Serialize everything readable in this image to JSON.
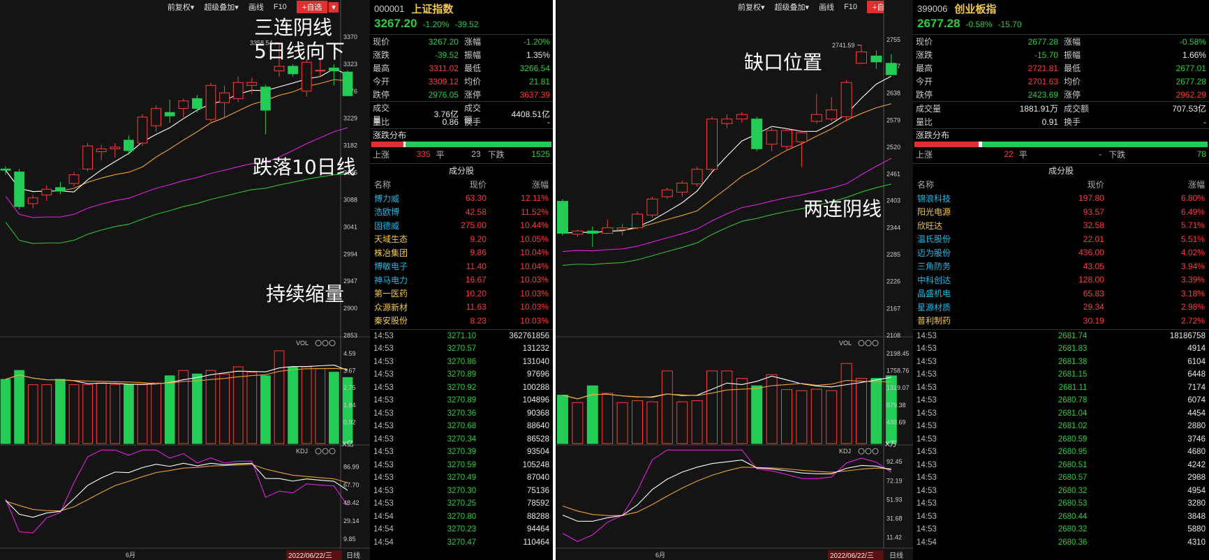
{
  "toolbar": {
    "restore": "前复权▾",
    "overlay": "超级叠加▾",
    "draw": "画线",
    "f10": "F10",
    "favorite": "+自选",
    "favorite_arrow": "▾",
    "close": "✕"
  },
  "colors": {
    "up": "#ff3b3b",
    "down": "#22cc55",
    "ma5": "#ffffff",
    "ma10": "#f0a030",
    "ma20": "#e020e0",
    "ma60": "#30c030"
  },
  "left_chart": {
    "price_axis": [
      "3370",
      "3323",
      "3276",
      "3229",
      "3182",
      "3135",
      "3088",
      "3041",
      "2994",
      "2947",
      "2900",
      "2853"
    ],
    "peak_label": "3358.54",
    "vol_label": "VOL",
    "vol_axis": [
      "4.59",
      "3.67",
      "2.75",
      "1.84",
      "0.92"
    ],
    "vol_unit": "X亿",
    "kdj_label": "KDJ",
    "kdj_axis": [
      "86.99",
      "67.70",
      "48.42",
      "29.14",
      "9.85"
    ],
    "month_label": "6月",
    "date_label": "2022/06/22/三",
    "period_label": "日线",
    "annotations": [
      "三连阴线",
      "5日线向下",
      "跌落10日线",
      "持续缩量"
    ],
    "candles": [
      {
        "o": 3140,
        "c": 3138,
        "h": 3145,
        "l": 3130
      },
      {
        "o": 3135,
        "c": 3075,
        "h": 3140,
        "l": 3070
      },
      {
        "o": 3080,
        "c": 3090,
        "h": 3095,
        "l": 3072
      },
      {
        "o": 3095,
        "c": 3105,
        "h": 3112,
        "l": 3085
      },
      {
        "o": 3108,
        "c": 3102,
        "h": 3118,
        "l": 3096
      },
      {
        "o": 3115,
        "c": 3130,
        "h": 3135,
        "l": 3110
      },
      {
        "o": 3140,
        "c": 3180,
        "h": 3185,
        "l": 3136
      },
      {
        "o": 3170,
        "c": 3175,
        "h": 3182,
        "l": 3155
      },
      {
        "o": 3175,
        "c": 3178,
        "h": 3185,
        "l": 3160
      },
      {
        "o": 3190,
        "c": 3172,
        "h": 3198,
        "l": 3165
      },
      {
        "o": 3185,
        "c": 3230,
        "h": 3235,
        "l": 3180
      },
      {
        "o": 3215,
        "c": 3245,
        "h": 3250,
        "l": 3205
      },
      {
        "o": 3238,
        "c": 3232,
        "h": 3260,
        "l": 3220
      },
      {
        "o": 3245,
        "c": 3258,
        "h": 3262,
        "l": 3230
      },
      {
        "o": 3262,
        "c": 3245,
        "h": 3268,
        "l": 3238
      },
      {
        "o": 3226,
        "c": 3285,
        "h": 3290,
        "l": 3222
      },
      {
        "o": 3255,
        "c": 3272,
        "h": 3285,
        "l": 3228
      },
      {
        "o": 3262,
        "c": 3290,
        "h": 3300,
        "l": 3256
      },
      {
        "o": 3285,
        "c": 3290,
        "h": 3298,
        "l": 3270
      },
      {
        "o": 3282,
        "c": 3242,
        "h": 3286,
        "l": 3200
      },
      {
        "o": 3310,
        "c": 3318,
        "h": 3358.54,
        "l": 3300
      },
      {
        "o": 3318,
        "c": 3305,
        "h": 3322,
        "l": 3300
      },
      {
        "o": 3275,
        "c": 3325,
        "h": 3330,
        "l": 3265
      },
      {
        "o": 3310,
        "c": 3311,
        "h": 3330,
        "l": 3300
      },
      {
        "o": 3315,
        "c": 3310,
        "h": 3322,
        "l": 3285
      },
      {
        "o": 3308,
        "c": 3267,
        "h": 3311,
        "l": 3266
      }
    ],
    "vol": [
      3.6,
      4.1,
      3.3,
      3.3,
      3.6,
      3.3,
      3.3,
      3.4,
      3.3,
      3.3,
      3.3,
      3.4,
      3.8,
      4.1,
      3.9,
      4.1,
      3.9,
      4.3,
      4.0,
      3.8,
      5.2,
      4.3,
      4.3,
      4.2,
      4.0,
      3.7
    ]
  },
  "left_quote": {
    "code": "000001",
    "name": "上证指数",
    "price": "3267.20",
    "pct": "-1.20%",
    "chg": "-39.52",
    "stats": [
      [
        "现价",
        "3267.20",
        "涨幅",
        "-1.20%"
      ],
      [
        "涨跌",
        "-39.52",
        "振幅",
        "1.35%"
      ],
      [
        "最高",
        "3311.02",
        "最低",
        "3266.54"
      ],
      [
        "今开",
        "3309.12",
        "均价",
        "21.81"
      ],
      [
        "跌停",
        "2976.05",
        "涨停",
        "3637.39"
      ],
      [
        "成交量",
        "3.76亿",
        "成交额",
        "4408.51亿"
      ],
      [
        "量比",
        "0.86",
        "换手",
        "-"
      ]
    ],
    "dist_title": "涨跌分布",
    "dist": {
      "up_label": "上涨",
      "up": "335",
      "flat_label": "平",
      "flat": "23",
      "down_label": "下跌",
      "down": "1525"
    },
    "comp_title": "成分股",
    "comp_head": [
      "名称",
      "现价",
      "涨幅"
    ],
    "components": [
      [
        "博力威",
        "63.30",
        "12.11%"
      ],
      [
        "浩欧博",
        "42.58",
        "11.52%"
      ],
      [
        "固德威",
        "275.00",
        "10.44%"
      ],
      [
        "天域生态",
        "9.20",
        "10.05%"
      ],
      [
        "株冶集团",
        "9.86",
        "10.04%"
      ],
      [
        "博敏电子",
        "11.40",
        "10.04%"
      ],
      [
        "神马电力",
        "16.67",
        "10.03%"
      ],
      [
        "第一医药",
        "10.20",
        "10.03%"
      ],
      [
        "众源新材",
        "11.63",
        "10.03%"
      ],
      [
        "秦安股份",
        "8.23",
        "10.03%"
      ]
    ],
    "trades": [
      [
        "14:53",
        "3271.10",
        "362761856"
      ],
      [
        "14:53",
        "3270.57",
        "131232"
      ],
      [
        "14:53",
        "3270.86",
        "131040"
      ],
      [
        "14:53",
        "3270.89",
        "97696"
      ],
      [
        "14:53",
        "3270.92",
        "100288"
      ],
      [
        "14:53",
        "3270.89",
        "104896"
      ],
      [
        "14:53",
        "3270.36",
        "90368"
      ],
      [
        "14:53",
        "3270.68",
        "88640"
      ],
      [
        "14:53",
        "3270.34",
        "86528"
      ],
      [
        "14:53",
        "3270.39",
        "93504"
      ],
      [
        "14:53",
        "3270.59",
        "105248"
      ],
      [
        "14:53",
        "3270.49",
        "87040"
      ],
      [
        "14:53",
        "3270.30",
        "75136"
      ],
      [
        "14:53",
        "3270.25",
        "78592"
      ],
      [
        "14:54",
        "3270.80",
        "88288"
      ],
      [
        "14:54",
        "3270.23",
        "94464"
      ],
      [
        "14:54",
        "3270.47",
        "110464"
      ]
    ]
  },
  "right_chart": {
    "price_axis": [
      "2755",
      "2697",
      "2638",
      "2579",
      "2520",
      "2461",
      "2403",
      "2344",
      "2285",
      "2226",
      "2167",
      "2108"
    ],
    "peak_label": "2741.59",
    "vol_label": "VOL",
    "vol_axis": [
      "2198.45",
      "1758.76",
      "1319.07",
      "879.38",
      "439.69"
    ],
    "vol_unit": "X万",
    "kdj_label": "KDJ",
    "kdj_axis": [
      "92.45",
      "72.19",
      "51.93",
      "31.68",
      "11.42"
    ],
    "month_label": "6月",
    "date_label": "2022/06/22/三",
    "period_label": "日线",
    "annotations": [
      "缺口位置",
      "两连阴线"
    ],
    "candles": [
      {
        "o": 2400,
        "c": 2330,
        "h": 2405,
        "l": 2325
      },
      {
        "o": 2328,
        "c": 2335,
        "h": 2338,
        "l": 2322
      },
      {
        "o": 2335,
        "c": 2330,
        "h": 2345,
        "l": 2300
      },
      {
        "o": 2330,
        "c": 2342,
        "h": 2360,
        "l": 2328
      },
      {
        "o": 2338,
        "c": 2342,
        "h": 2350,
        "l": 2325
      },
      {
        "o": 2342,
        "c": 2372,
        "h": 2378,
        "l": 2338
      },
      {
        "o": 2370,
        "c": 2405,
        "h": 2410,
        "l": 2365
      },
      {
        "o": 2410,
        "c": 2425,
        "h": 2430,
        "l": 2405
      },
      {
        "o": 2420,
        "c": 2440,
        "h": 2445,
        "l": 2410
      },
      {
        "o": 2438,
        "c": 2470,
        "h": 2475,
        "l": 2432
      },
      {
        "o": 2470,
        "c": 2580,
        "h": 2585,
        "l": 2465
      },
      {
        "o": 2570,
        "c": 2580,
        "h": 2590,
        "l": 2560
      },
      {
        "o": 2580,
        "c": 2590,
        "h": 2595,
        "l": 2572
      },
      {
        "o": 2580,
        "c": 2515,
        "h": 2585,
        "l": 2510
      },
      {
        "o": 2525,
        "c": 2555,
        "h": 2565,
        "l": 2510
      },
      {
        "o": 2520,
        "c": 2555,
        "h": 2560,
        "l": 2510
      },
      {
        "o": 2530,
        "c": 2550,
        "h": 2555,
        "l": 2475
      },
      {
        "o": 2575,
        "c": 2590,
        "h": 2635,
        "l": 2570
      },
      {
        "o": 2580,
        "c": 2600,
        "h": 2628,
        "l": 2575
      },
      {
        "o": 2585,
        "c": 2660,
        "h": 2665,
        "l": 2575
      },
      {
        "o": 2702,
        "c": 2727,
        "h": 2741.59,
        "l": 2700
      },
      {
        "o": 2718,
        "c": 2705,
        "h": 2730,
        "l": 2690
      },
      {
        "o": 2702,
        "c": 2677,
        "h": 2722,
        "l": 2677
      }
    ],
    "vol": [
      1300,
      1100,
      1550,
      1350,
      1100,
      1150,
      1120,
      1950,
      1120,
      1150,
      1950,
      1950,
      1750,
      1550,
      1850,
      1450,
      1420,
      1460,
      1420,
      2150,
      1750,
      1750,
      1820
    ]
  },
  "right_quote": {
    "code": "399006",
    "name": "创业板指",
    "price": "2677.28",
    "pct": "-0.58%",
    "chg": "-15.70",
    "stats": [
      [
        "现价",
        "2677.28",
        "涨幅",
        "-0.58%"
      ],
      [
        "涨跌",
        "-15.70",
        "振幅",
        "1.66%"
      ],
      [
        "最高",
        "2721.81",
        "最低",
        "2677.01"
      ],
      [
        "今开",
        "2701.63",
        "均价",
        "2677.28"
      ],
      [
        "跌停",
        "2423.69",
        "涨停",
        "2962.29"
      ],
      [
        "成交量",
        "1881.91万",
        "成交额",
        "707.53亿"
      ],
      [
        "量比",
        "0.91",
        "换手",
        "-"
      ]
    ],
    "dist_title": "涨跌分布",
    "dist": {
      "up_label": "上涨",
      "up": "22",
      "flat_label": "平",
      "flat": "-",
      "down_label": "下跌",
      "down": "78"
    },
    "comp_title": "成分股",
    "comp_head": [
      "名称",
      "现价",
      "涨幅"
    ],
    "components": [
      [
        "锦浪科技",
        "197.80",
        "6.80%"
      ],
      [
        "阳光电源",
        "93.57",
        "6.49%"
      ],
      [
        "欣旺达",
        "32.58",
        "5.71%"
      ],
      [
        "温氏股份",
        "22.01",
        "5.51%"
      ],
      [
        "迈为股份",
        "436.00",
        "4.02%"
      ],
      [
        "三角防务",
        "43.05",
        "3.94%"
      ],
      [
        "中科创达",
        "128.00",
        "3.39%"
      ],
      [
        "晶盛机电",
        "65.83",
        "3.18%"
      ],
      [
        "星源材质",
        "29.34",
        "2.98%"
      ],
      [
        "普利制药",
        "30.19",
        "2.72%"
      ]
    ],
    "trades": [
      [
        "14:53",
        "2681.74",
        "18186758"
      ],
      [
        "14:53",
        "2681.83",
        "4914"
      ],
      [
        "14:53",
        "2681.38",
        "6104"
      ],
      [
        "14:53",
        "2681.15",
        "6448"
      ],
      [
        "14:53",
        "2681.11",
        "7174"
      ],
      [
        "14:53",
        "2680.78",
        "6074"
      ],
      [
        "14:53",
        "2681.04",
        "4454"
      ],
      [
        "14:53",
        "2681.02",
        "2880"
      ],
      [
        "14:53",
        "2680.59",
        "3746"
      ],
      [
        "14:53",
        "2680.95",
        "4680"
      ],
      [
        "14:53",
        "2680.51",
        "4242"
      ],
      [
        "14:53",
        "2680.57",
        "2988"
      ],
      [
        "14:53",
        "2680.32",
        "4954"
      ],
      [
        "14:53",
        "2680.53",
        "3280"
      ],
      [
        "14:53",
        "2680.44",
        "3848"
      ],
      [
        "14:53",
        "2680.32",
        "5880"
      ],
      [
        "14:54",
        "2680.36",
        "4310"
      ]
    ]
  }
}
